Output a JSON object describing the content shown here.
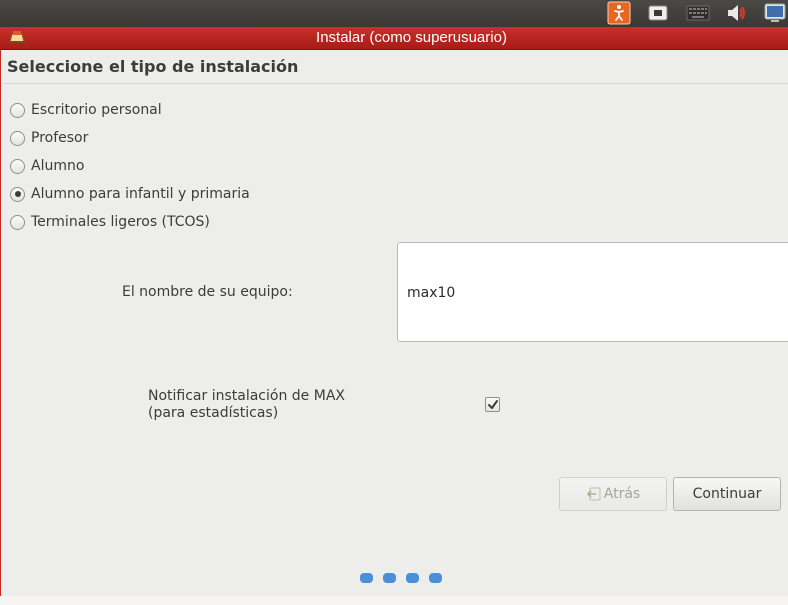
{
  "window": {
    "title": "Instalar (como superusuario)"
  },
  "tray": {
    "icons": [
      "accessibility-icon",
      "network-icon",
      "keyboard-icon",
      "sound-icon",
      "session-icon"
    ]
  },
  "section": {
    "title": "Seleccione el tipo de instalación"
  },
  "install_types": [
    {
      "label": "Escritorio personal",
      "selected": false
    },
    {
      "label": "Profesor",
      "selected": false
    },
    {
      "label": "Alumno",
      "selected": false
    },
    {
      "label": "Alumno para infantil y primaria",
      "selected": true
    },
    {
      "label": "Terminales ligeros (TCOS)",
      "selected": false
    }
  ],
  "hostname": {
    "label": "El nombre de su equipo:",
    "value": "max10"
  },
  "notify": {
    "label_line1": "Notificar instalación de MAX",
    "label_line2": "(para estadísticas)",
    "checked": true
  },
  "buttons": {
    "back_label": "Atrás",
    "continue_label": "Continuar"
  },
  "progress": {
    "total_steps": 4
  },
  "colors": {
    "title_bar": "#c42a24",
    "accent": "#4a90d9"
  }
}
